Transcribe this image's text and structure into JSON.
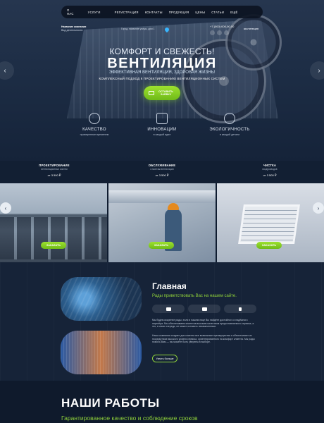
{
  "nav": {
    "items": [
      "О НАС",
      "УСЛУГИ",
      "РЕГИСТРАЦИЯ",
      "КОНТАКТЫ",
      "ПРОДУКЦИЯ",
      "ЦЕНЫ",
      "СТАТЬИ",
      "ЕЩЁ"
    ],
    "social_icons": [
      "youtube-icon",
      "vk-icon",
      "odnoklassniki-icon"
    ]
  },
  "header": {
    "company_name": "Название компании",
    "company_activity": "Вид деятельности",
    "address": "Город, название улицы, дом 1",
    "phone": "+7 (000) 000-00-00",
    "logo_text": "ВЕНТИЛЯЦИЯ"
  },
  "hero": {
    "kicker": "КОМФОРТ И СВЕЖЕСТЬ!",
    "title": "ВЕНТИЛЯЦИЯ",
    "subtitle": "ЭФФЕКТИВНАЯ ВЕНТИЛЯЦИЯ, ЗДОРОВАЯ ЖИЗНЬ!",
    "tagline": "КОМПЛЕКСНЫЙ ПОДХОД К ПРОЕКТИРОВАНИЮ ВЕНТИЛЯЦИОННЫХ СИСТЕМ",
    "cta_label": "ОСТАВИТЬ ЗАЯВКУ",
    "prev": "‹",
    "next": "›"
  },
  "features": [
    {
      "title": "КАЧЕСТВО",
      "subtitle": "проверенное временем",
      "icon": "leaf-icon"
    },
    {
      "title": "ИННОВАЦИИ",
      "subtitle": "в каждой идее",
      "icon": "fan-icon"
    },
    {
      "title": "ЭКОЛОГИЧНОСТЬ",
      "subtitle": "в каждой детали",
      "icon": "eco-icon"
    }
  ],
  "services": [
    {
      "title": "ПРОЕКТИРОВАНИЕ",
      "subtitle": "вентиляционных систем",
      "price": "от 3 500 ₽"
    },
    {
      "title": "ОБСЛУЖИВАНИЕ",
      "subtitle": "и монтаж вентиляции",
      "price": "от 3 500 ₽"
    },
    {
      "title": "ЧИСТКА",
      "subtitle": "воздуховодов",
      "price": "от 3 500 ₽"
    }
  ],
  "order_label": "ЗАКАЗАТЬ",
  "about": {
    "title": "Главная",
    "subtitle": "Рады приветствовать Вас на нашем сайте.",
    "p1": "Мы будем искренне рады, если в нашем лице Вы найдёте достойного и надёжного партнёра. Мы обеспечиваем клиентов высоким качеством предоставляемого сервиса, а это, в свою очередь, не может оставить незамеченным.",
    "p2": "Наша компания создает для клиента все возможные преимущества и обеспечивает их посредством высокого уровня сервиса, ориентированного на комфорт клиента. Мы рады помочь Вам — вы можете быть уверены в выборе.",
    "more_label": "Узнать больше"
  },
  "works": {
    "title": "НАШИ РАБОТЫ",
    "subtitle": "Гарантированное качество и соблюдение сроков"
  }
}
